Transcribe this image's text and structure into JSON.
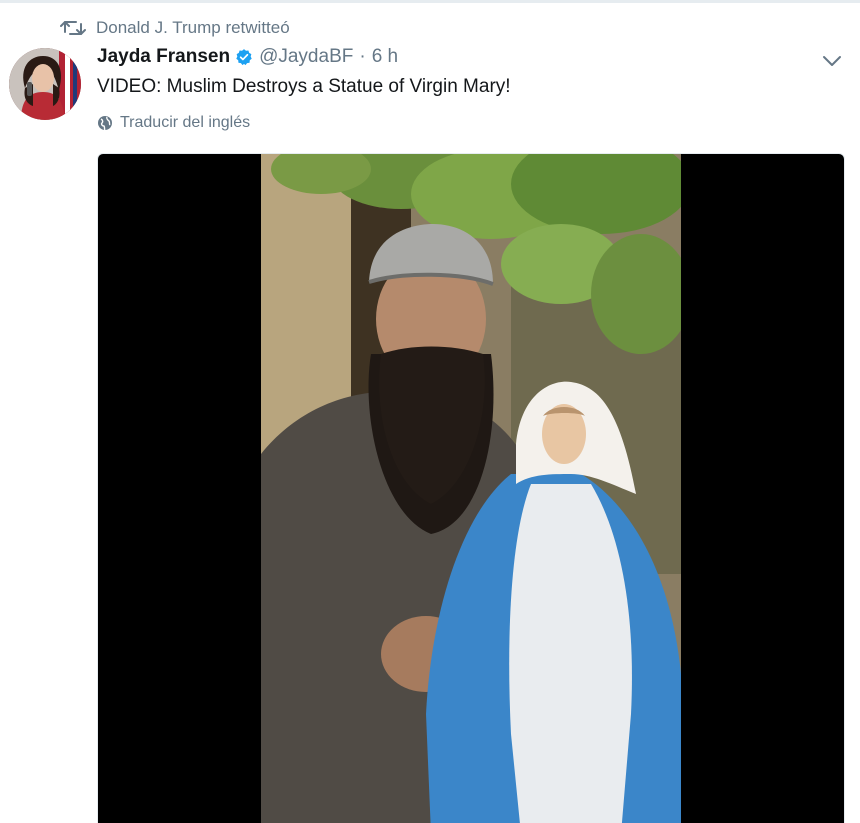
{
  "retweet_context": {
    "icon": "retweet-icon",
    "text": "Donald J. Trump retwitteó"
  },
  "tweet": {
    "author": {
      "fullname": "Jayda Fransen",
      "username": "@JaydaBF",
      "verified": true,
      "avatar_icon": "avatar"
    },
    "separator": "·",
    "timestamp": "6 h",
    "text": "VIDEO: Muslim Destroys a Statue of Virgin Mary!",
    "translate_label": "Traducir del inglés",
    "media_type": "video"
  },
  "colors": {
    "secondary_text": "#657786",
    "primary_text": "#14171a",
    "verified_blue": "#1da1f2",
    "media_background": "#000000"
  }
}
